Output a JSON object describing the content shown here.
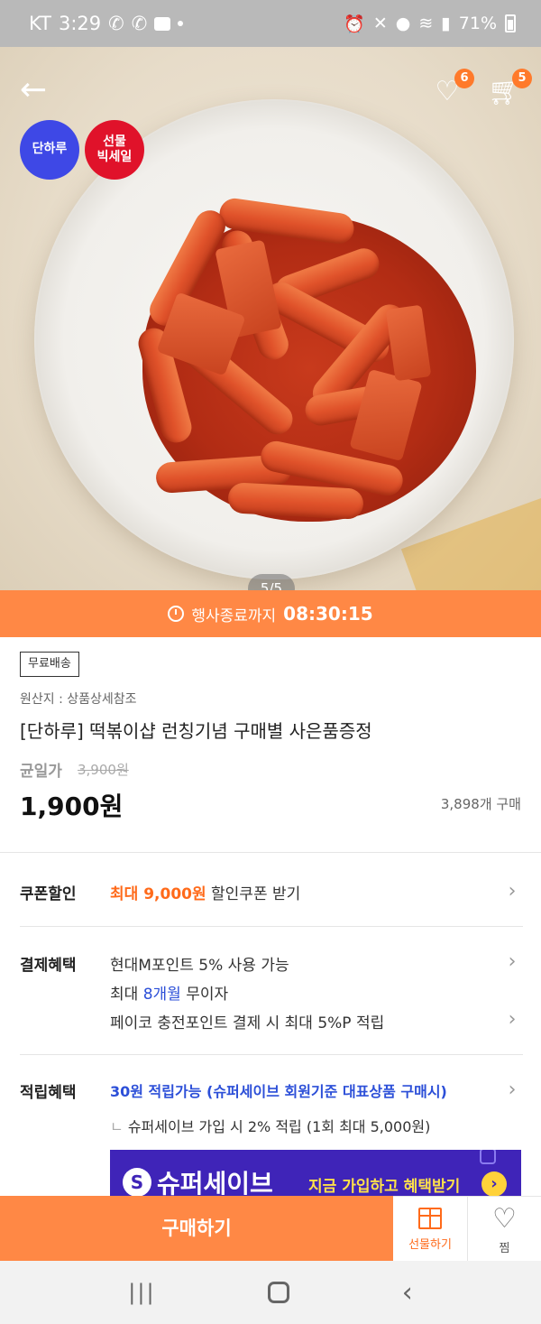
{
  "status_bar": {
    "carrier": "KT",
    "time": "3:29",
    "battery": "71%"
  },
  "header": {
    "wishlist_count": "6",
    "cart_count": "5"
  },
  "hero": {
    "badge_1": "단하루",
    "badge_2_line1": "선물",
    "badge_2_line2": "빅세일",
    "pager": "5/5"
  },
  "timer": {
    "label": "행사종료까지",
    "value": "08:30:15"
  },
  "product": {
    "shipping_tag": "무료배송",
    "origin": "원산지 : 상품상세참조",
    "title": "[단하루] 떡볶이샵 런칭기념 구매별 사은품증정",
    "price_label": "균일가",
    "original_price": "3,900원",
    "sale_price": "1,900원",
    "sold_count": "3,898개 구매"
  },
  "benefits": {
    "coupon": {
      "label": "쿠폰할인",
      "highlight": "최대 9,000원",
      "text": " 할인쿠폰 받기"
    },
    "payment": {
      "label": "결제혜택",
      "line1": "현대M포인트 5% 사용 가능",
      "line2_prefix": "최대 ",
      "line2_highlight": "8개월",
      "line2_suffix": " 무이자",
      "line3": "페이코 충전포인트 결제 시 최대 5%P 적립"
    },
    "points": {
      "label": "적립혜택",
      "line1": "30원 적립가능 (슈퍼세이브 회원기준 대표상품 구매시)",
      "bullet": "ㄴ",
      "line2": "슈퍼세이브 가입 시 2% 적립 (1회 최대 5,000원)"
    }
  },
  "banner": {
    "logo": "S",
    "brand": "슈퍼세이브",
    "cta": "지금 가입하고 혜택받기"
  },
  "bottom_bar": {
    "buy_label": "구매하기",
    "gift_label": "선물하기",
    "wish_label": "찜"
  },
  "colors": {
    "accent_orange": "#ff8845",
    "badge_blue": "#3e48e6",
    "badge_red": "#e0122a",
    "banner_purple": "#3f24b8"
  }
}
